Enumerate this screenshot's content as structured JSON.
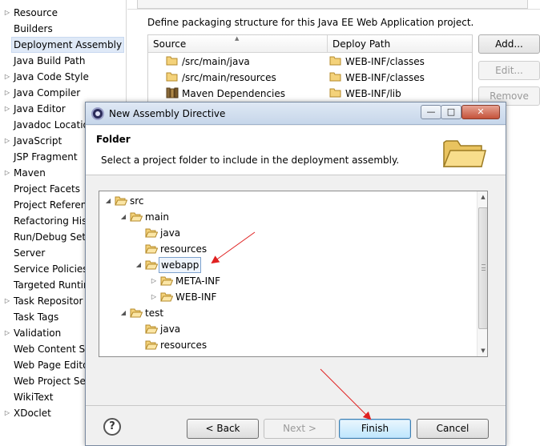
{
  "nav_tree": {
    "items": [
      {
        "label": "Resource",
        "expandable": true
      },
      {
        "label": "Builders",
        "expandable": false
      },
      {
        "label": "Deployment Assembly",
        "expandable": false,
        "selected": true
      },
      {
        "label": "Java Build Path",
        "expandable": false
      },
      {
        "label": "Java Code Style",
        "expandable": true
      },
      {
        "label": "Java Compiler",
        "expandable": true
      },
      {
        "label": "Java Editor",
        "expandable": true
      },
      {
        "label": "Javadoc Locatio",
        "expandable": false
      },
      {
        "label": "JavaScript",
        "expandable": true
      },
      {
        "label": "JSP Fragment",
        "expandable": false
      },
      {
        "label": "Maven",
        "expandable": true
      },
      {
        "label": "Project Facets",
        "expandable": false
      },
      {
        "label": "Project Referen",
        "expandable": false
      },
      {
        "label": "Refactoring His",
        "expandable": false
      },
      {
        "label": "Run/Debug Sett",
        "expandable": false
      },
      {
        "label": "Server",
        "expandable": false
      },
      {
        "label": "Service Policies",
        "expandable": false
      },
      {
        "label": "Targeted Runtir",
        "expandable": false
      },
      {
        "label": "Task Repositor",
        "expandable": true
      },
      {
        "label": "Task Tags",
        "expandable": false
      },
      {
        "label": "Validation",
        "expandable": true
      },
      {
        "label": "Web Content Se",
        "expandable": false
      },
      {
        "label": "Web Page Edito",
        "expandable": false
      },
      {
        "label": "Web Project Set",
        "expandable": false
      },
      {
        "label": "WikiText",
        "expandable": false
      },
      {
        "label": "XDoclet",
        "expandable": true
      }
    ]
  },
  "assembly": {
    "description": "Define packaging structure for this Java EE Web Application project.",
    "columns": {
      "source": "Source",
      "deploy_path": "Deploy Path"
    },
    "rows": [
      {
        "source": "/src/main/java",
        "deploy_path": "WEB-INF/classes",
        "source_icon": "folder-icon"
      },
      {
        "source": "/src/main/resources",
        "deploy_path": "WEB-INF/classes",
        "source_icon": "folder-icon"
      },
      {
        "source": "Maven Dependencies",
        "deploy_path": "WEB-INF/lib",
        "source_icon": "library-icon"
      }
    ],
    "buttons": {
      "add": "Add...",
      "edit": "Edit...",
      "remove": "Remove"
    }
  },
  "dialog": {
    "title": "New Assembly Directive",
    "window_buttons": {
      "minimize": "—",
      "maximize": "□",
      "close": "✕"
    },
    "banner": {
      "title": "Folder",
      "description": "Select a project folder to include in the deployment assembly."
    },
    "tree": {
      "items": [
        {
          "label": "src",
          "level": 0,
          "expander": "expanded"
        },
        {
          "label": "main",
          "level": 1,
          "expander": "expanded"
        },
        {
          "label": "java",
          "level": 2,
          "expander": "none"
        },
        {
          "label": "resources",
          "level": 2,
          "expander": "none"
        },
        {
          "label": "webapp",
          "level": 2,
          "expander": "expanded",
          "selected": true
        },
        {
          "label": "META-INF",
          "level": 3,
          "expander": "collapsed"
        },
        {
          "label": "WEB-INF",
          "level": 3,
          "expander": "collapsed"
        },
        {
          "label": "test",
          "level": 1,
          "expander": "expanded"
        },
        {
          "label": "java",
          "level": 2,
          "expander": "none"
        },
        {
          "label": "resources",
          "level": 2,
          "expander": "none"
        }
      ]
    },
    "buttons": {
      "help": "?",
      "back": "< Back",
      "next": "Next >",
      "finish": "Finish",
      "cancel": "Cancel"
    }
  },
  "colors": {
    "folder_fill": "#f4d27a",
    "folder_stroke": "#b48a2a",
    "annotation_arrow": "#e02020",
    "title_bar": "#c6d6ea"
  }
}
